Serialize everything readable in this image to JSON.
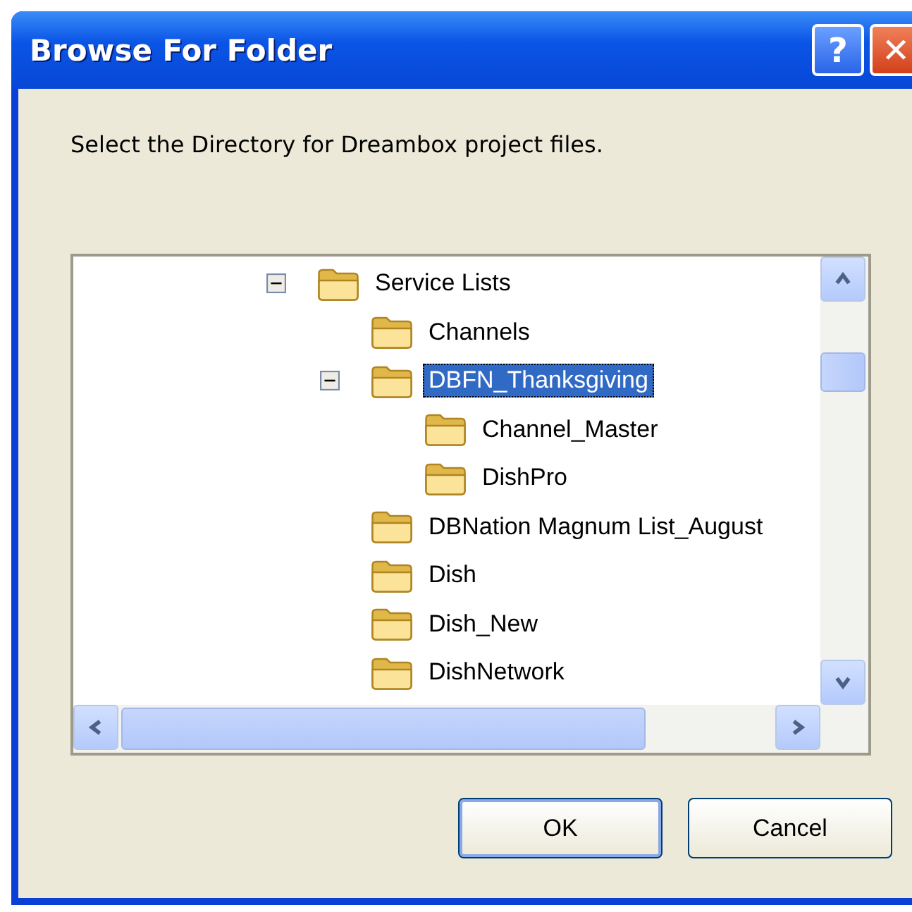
{
  "window": {
    "title": "Browse For Folder",
    "title_buttons": [
      {
        "kind": "help",
        "label": "?"
      },
      {
        "kind": "close",
        "label": "✕"
      }
    ]
  },
  "prompt": "Select the Directory for Dreambox project files.",
  "tree": [
    {
      "label": "Service Lists",
      "expanded": true,
      "selected": false,
      "children": [
        {
          "label": "Channels",
          "selected": false
        },
        {
          "label": "DBFN_Thanksgiving",
          "expanded": true,
          "selected": true,
          "children": [
            {
              "label": "Channel_Master",
              "selected": false
            },
            {
              "label": "DishPro",
              "selected": false
            }
          ]
        },
        {
          "label": "DBNation Magnum List_August",
          "selected": false
        },
        {
          "label": "Dish",
          "selected": false
        },
        {
          "label": "Dish_New",
          "selected": false
        },
        {
          "label": "DishNetwork",
          "selected": false
        }
      ]
    }
  ],
  "buttons": [
    {
      "label": "OK",
      "default": true
    },
    {
      "label": "Cancel",
      "default": false
    }
  ]
}
